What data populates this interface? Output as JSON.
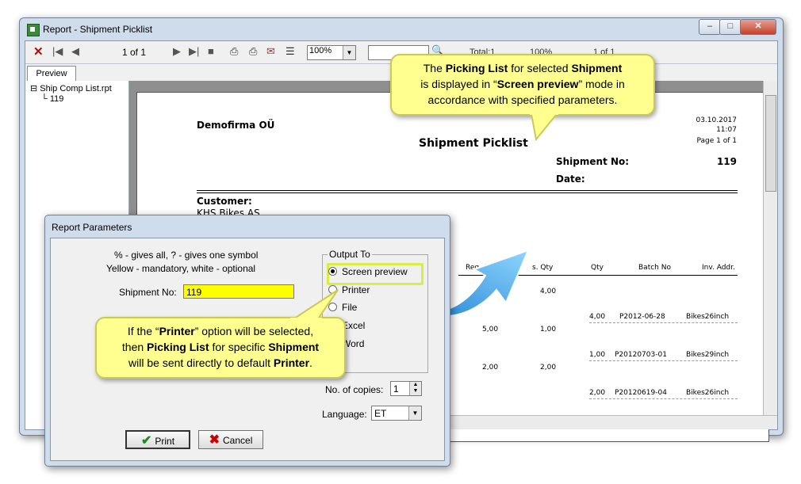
{
  "window": {
    "title": "Report - Shipment Picklist",
    "min_label": "‒",
    "max_label": "□",
    "close_label": "✕"
  },
  "toolbar": {
    "page_of": "1 of 1",
    "zoom": "100%",
    "total": "Total:1",
    "percent": "100%",
    "page_of_right": "1 of 1"
  },
  "tabs": {
    "preview": "Preview"
  },
  "tree": {
    "root": "Ship Comp List.rpt",
    "child": "119"
  },
  "report": {
    "company": "Demofirma OÜ",
    "title": "Shipment Picklist",
    "date": "03.10.2017",
    "time": "11:07",
    "page": "Page 1 of 1",
    "shipment_no_label": "Shipment No:",
    "shipment_no": "119",
    "date_label": "Date:",
    "customer_label": "Customer:",
    "customer_name": "KHS Bikes AS",
    "columns": [
      "Req. Qty",
      "s. Qty",
      "Qty",
      "Batch No",
      "Inv. Addr."
    ],
    "rows": [
      {
        "req_qty": "",
        "s_qty": "4,00",
        "qty": "",
        "batch": "",
        "inv": ""
      },
      {
        "req_qty": "",
        "s_qty": "",
        "qty": "4,00",
        "batch": "P2012-06-28",
        "inv": "Bikes26inch"
      },
      {
        "req_qty": "5,00",
        "s_qty": "1,00",
        "qty": "",
        "batch": "",
        "inv": ""
      },
      {
        "req_qty": "",
        "s_qty": "",
        "qty": "1,00",
        "batch": "P20120703-01",
        "inv": "Bikes29inch"
      },
      {
        "req_qty": "2,00",
        "s_qty": "2,00",
        "qty": "",
        "batch": "",
        "inv": ""
      },
      {
        "req_qty": "",
        "s_qty": "",
        "qty": "2,00",
        "batch": "P20120619-04",
        "inv": "Bikes26inch"
      }
    ]
  },
  "dialog": {
    "title": "Report Parameters",
    "hint1": "% - gives all, ? - gives one symbol",
    "hint2": "Yellow - mandatory, white - optional",
    "shipment_label": "Shipment No:",
    "shipment_value": "119",
    "output_group": "Output To",
    "options": [
      "Screen preview",
      "Printer",
      "File",
      "Excel",
      "Word"
    ],
    "copies_label": "No. of copies:",
    "copies_value": "1",
    "language_label": "Language:",
    "language_value": "ET",
    "print_label": "Print",
    "cancel_label": "Cancel"
  },
  "callouts": {
    "top": {
      "l1a": "The ",
      "l1b": "Picking List",
      "l1c": " for selected ",
      "l1d": "Shipment",
      "l2a": "is displayed in “",
      "l2b": "Screen preview",
      "l2c": "” mode in",
      "l3": "accordance with specified parameters."
    },
    "bottom": {
      "l1a": "If the “",
      "l1b": "Printer",
      "l1c": "” option will be selected,",
      "l2a": "then ",
      "l2b": "Picking List",
      "l2c": " for specific ",
      "l2d": "Shipment",
      "l3a": "will be sent directly to default ",
      "l3b": "Printer",
      "l3c": "."
    }
  },
  "colors": {
    "mandatory_field": "#ffff00",
    "callout_bg": "#ffff8f",
    "arrow": "#3aa7e6"
  }
}
